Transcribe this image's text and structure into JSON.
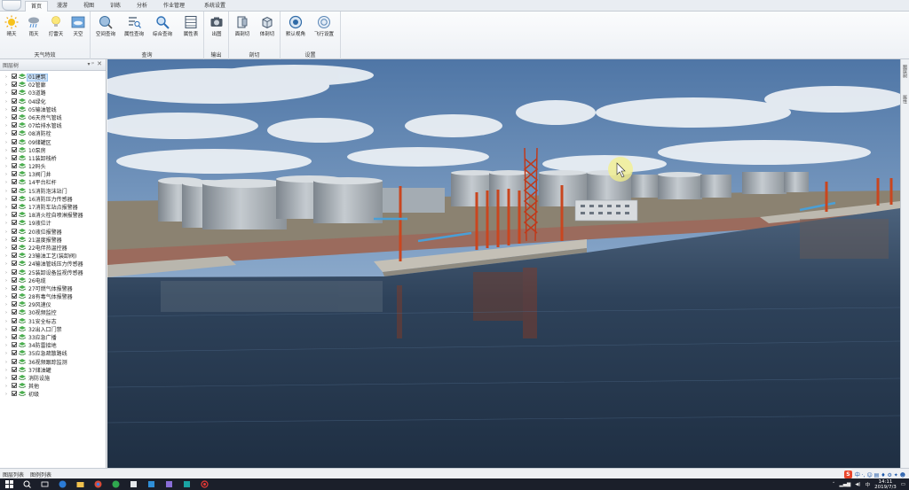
{
  "tabs": [
    "首页",
    "漫游",
    "视图",
    "训练",
    "分析",
    "作业管理",
    "系统设置"
  ],
  "active_tab": 0,
  "ribbon_groups": [
    {
      "label": "天气特效",
      "buttons": [
        "晴天",
        "雨天",
        "打雷天",
        "天空"
      ]
    },
    {
      "label": "查询",
      "buttons": [
        "空间查询",
        "属性查询",
        "综合查询",
        "属性表"
      ]
    },
    {
      "label": "输出",
      "buttons": [
        "出图"
      ]
    },
    {
      "label": "剖切",
      "buttons": [
        "面剖切",
        "体剖切"
      ]
    },
    {
      "label": "设置",
      "buttons": [
        "默认视角",
        "飞行设置"
      ]
    }
  ],
  "panel": {
    "title": "图层树",
    "pin": "▾ ᵖ",
    "close": "✕"
  },
  "layers": [
    "01建筑",
    "02管廊",
    "03道路",
    "04绿化",
    "05输油管线",
    "06天然气管线",
    "07给排水管线",
    "08消防栓",
    "09储罐区",
    "10泵房",
    "11装卸栈桥",
    "12码头",
    "13阀门井",
    "14平台栏杆",
    "15消防泡沫站门",
    "16消防压力传感器",
    "17消防车站点报警器",
    "18消火栓自喷淋报警器",
    "19液位计",
    "20液位报警器",
    "21温度报警器",
    "22电伴热温控器",
    "23输油工艺(装卸阀)",
    "24输油管线压力传感器",
    "25装卸设备监视传感器",
    "26电缆",
    "27可燃气体报警器",
    "28有毒气体报警器",
    "29风速仪",
    "30视频监控",
    "31安全标志",
    "32出入口门禁",
    "33应急广播",
    "34防雷接地",
    "35应急疏散路线",
    "36视频跟踪监测",
    "37储油罐",
    "消防设施",
    "其他",
    "初级"
  ],
  "selected_layer": 0,
  "right_bar": [
    "图层树",
    "属性"
  ],
  "status": {
    "left": "图层列表",
    "left2": "图例列表"
  },
  "ime": {
    "logo": "S",
    "text": "中 ·, ☺ ▤ ♦ ⚙ ✦ ☻"
  },
  "taskbar": {
    "time": "14:11",
    "date": "2019/7/3"
  },
  "colors": {
    "accent": "#3f86d9",
    "sky_top": "#5a80ad",
    "water": "#2a3d55"
  }
}
